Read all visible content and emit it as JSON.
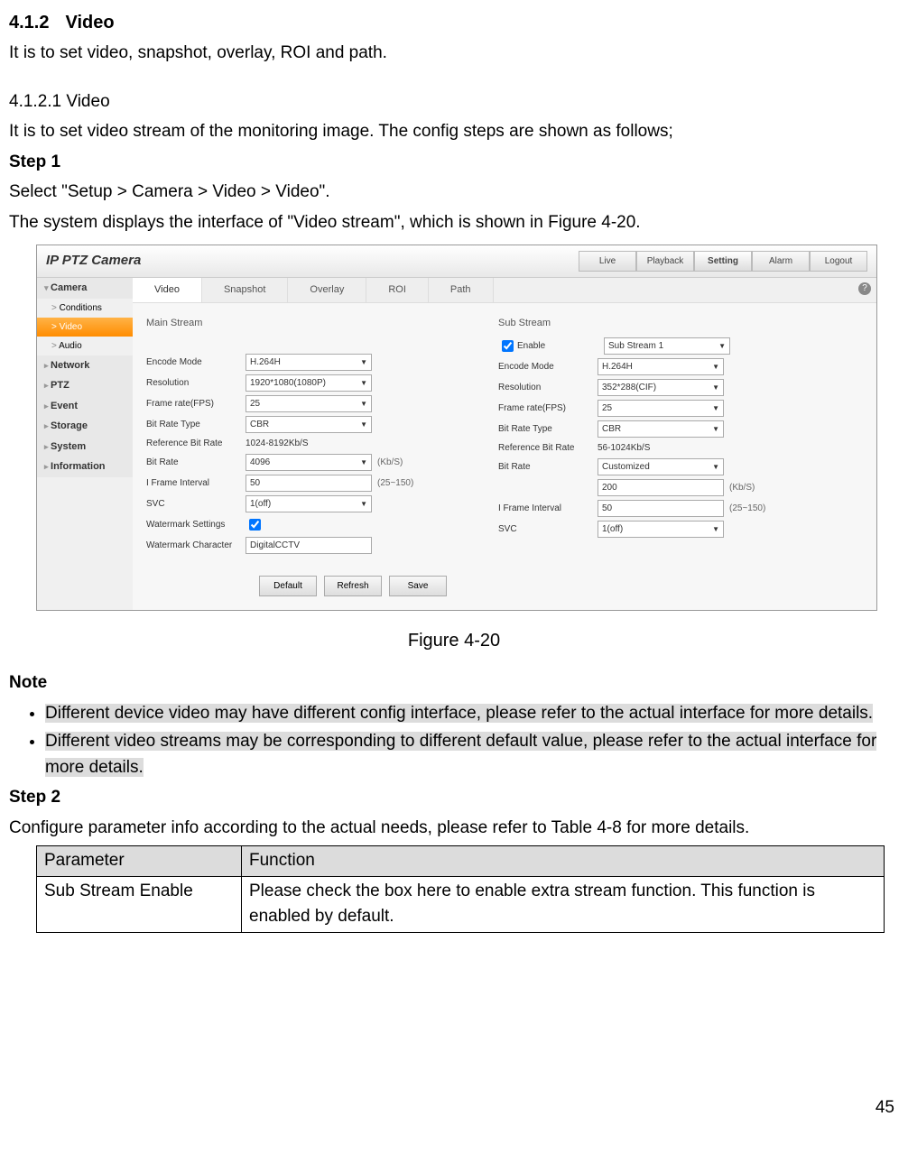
{
  "heading": {
    "num": "4.1.2",
    "title": "Video"
  },
  "intro": "It is to set video, snapshot, overlay, ROI and path.",
  "sub_heading": "4.1.2.1 Video",
  "sub_intro": "It is to set video stream of the monitoring image. The config steps are shown as follows;",
  "step1_label": "Step 1",
  "step1_text": "Select \"Setup > Camera > Video > Video\".",
  "step1_text2": "The system displays the interface of \"Video stream\", which is shown in Figure 4-20.",
  "figure_caption": "Figure 4-20",
  "note_label": "Note",
  "note1": "Different device video may have different config interface, please refer to the actual interface for more details.",
  "note2": "Different video streams may be corresponding to different default value, please refer to the actual interface for more details.",
  "step2_label": "Step 2",
  "step2_text": "Configure parameter info according to the actual needs, please refer to Table 4-8 for more details.",
  "table": {
    "h1": "Parameter",
    "h2": "Function",
    "r1c1": "Sub Stream Enable",
    "r1c2": "Please check the box here to enable extra stream function. This function is enabled by default."
  },
  "page_number": "45",
  "ui": {
    "brand": "IP PTZ Camera",
    "nav": {
      "live": "Live",
      "playback": "Playback",
      "setting": "Setting",
      "alarm": "Alarm",
      "logout": "Logout"
    },
    "help": "?",
    "sidebar": {
      "camera": "Camera",
      "conditions": "Conditions",
      "video": "Video",
      "audio": "Audio",
      "network": "Network",
      "ptz": "PTZ",
      "event": "Event",
      "storage": "Storage",
      "system": "System",
      "information": "Information"
    },
    "subtabs": {
      "video": "Video",
      "snapshot": "Snapshot",
      "overlay": "Overlay",
      "roi": "ROI",
      "path": "Path"
    },
    "main": {
      "title": "Main Stream",
      "encode_mode": {
        "label": "Encode Mode",
        "value": "H.264H"
      },
      "resolution": {
        "label": "Resolution",
        "value": "1920*1080(1080P)"
      },
      "fps": {
        "label": "Frame rate(FPS)",
        "value": "25"
      },
      "brt": {
        "label": "Bit Rate Type",
        "value": "CBR"
      },
      "ref": {
        "label": "Reference Bit Rate",
        "value": "1024-8192Kb/S"
      },
      "bitrate": {
        "label": "Bit Rate",
        "value": "4096",
        "hint": "(Kb/S)"
      },
      "iframe": {
        "label": "I Frame Interval",
        "value": "50",
        "hint": "(25~150)"
      },
      "svc": {
        "label": "SVC",
        "value": "1(off)"
      },
      "wm": {
        "label": "Watermark Settings"
      },
      "wmc": {
        "label": "Watermark Character",
        "value": "DigitalCCTV"
      }
    },
    "sub": {
      "title": "Sub Stream",
      "enable": {
        "label": "Enable",
        "value": "Sub Stream 1"
      },
      "encode_mode": {
        "label": "Encode Mode",
        "value": "H.264H"
      },
      "resolution": {
        "label": "Resolution",
        "value": "352*288(CIF)"
      },
      "fps": {
        "label": "Frame rate(FPS)",
        "value": "25"
      },
      "brt": {
        "label": "Bit Rate Type",
        "value": "CBR"
      },
      "ref": {
        "label": "Reference Bit Rate",
        "value": "56-1024Kb/S"
      },
      "bitrate": {
        "label": "Bit Rate",
        "value": "Customized"
      },
      "bitrate2": {
        "value": "200",
        "hint": "(Kb/S)"
      },
      "iframe": {
        "label": "I Frame Interval",
        "value": "50",
        "hint": "(25~150)"
      },
      "svc": {
        "label": "SVC",
        "value": "1(off)"
      }
    },
    "buttons": {
      "default": "Default",
      "refresh": "Refresh",
      "save": "Save"
    }
  }
}
